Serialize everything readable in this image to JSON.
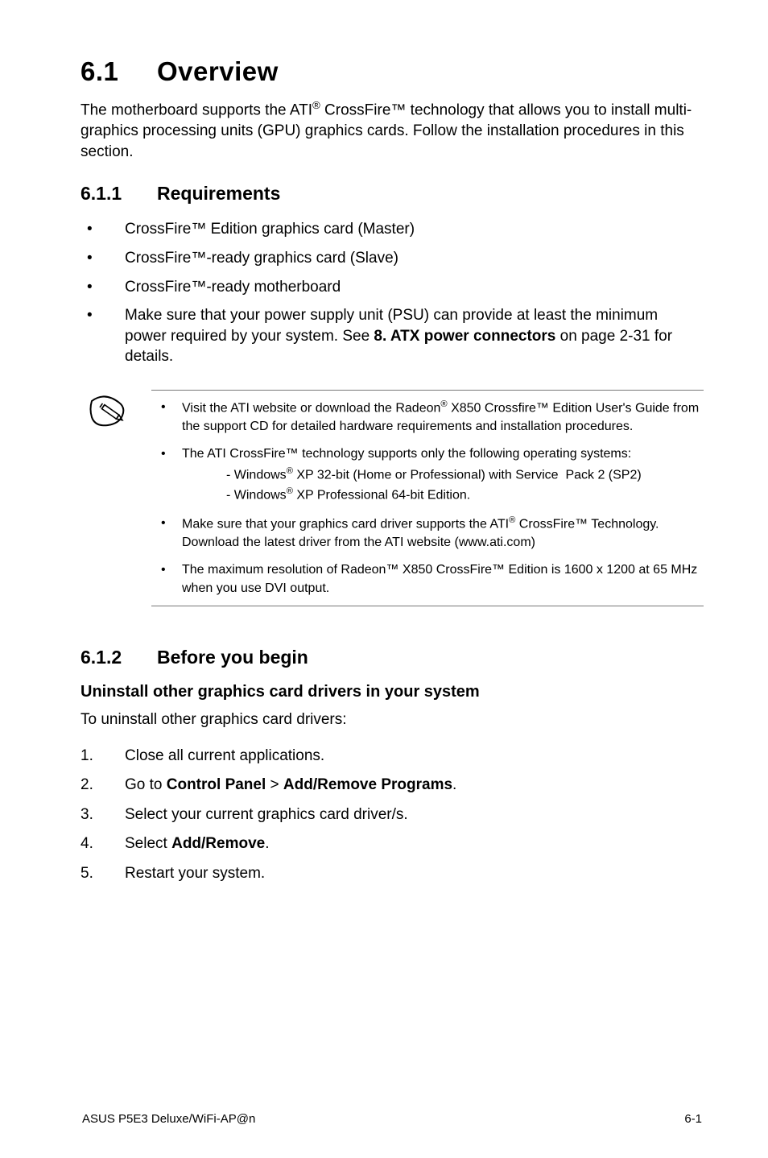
{
  "heading": {
    "num": "6.1",
    "title": "Overview"
  },
  "intro": "The motherboard supports the ATI® CrossFire™ technology that allows you to install multi-graphics processing units (GPU) graphics cards. Follow the installation procedures in this section.",
  "sec611": {
    "num": "6.1.1",
    "title": "Requirements",
    "items": [
      "CrossFire™ Edition graphics card (Master)",
      "CrossFire™-ready graphics card (Slave)",
      "CrossFire™-ready motherboard",
      "Make sure that your power supply unit (PSU) can provide at least the minimum power required by your system. See 8. ATX power connectors on page 2-31 for details."
    ]
  },
  "note": {
    "n1": "Visit the ATI website or download the Radeon® X850 Crossfire™ Edition User's Guide from the support CD for detailed hardware requirements and installation procedures.",
    "n2": "The ATI CrossFire™ technology supports only the following operating systems:",
    "n2_sub1": "- Windows® XP 32-bit  (Home or Professional) with Service Pack 2 (SP2)",
    "n2_sub2": "- Windows® XP Professional 64-bit Edition.",
    "n3": "Make sure that your graphics card driver supports the ATI® CrossFire™ Technology. Download the latest driver from the ATI website (www.ati.com)",
    "n4": "The maximum resolution of Radeon™ X850 CrossFire™ Edition is 1600 x 1200 at 65 MHz when you use DVI output."
  },
  "sec612": {
    "num": "6.1.2",
    "title": "Before you begin",
    "subheading": "Uninstall other graphics card drivers in your system",
    "lead": "To uninstall other graphics card drivers:",
    "steps": {
      "s1": "Close all current applications.",
      "s2_pre": "Go to ",
      "s2_b1": "Control Panel",
      "s2_mid": " > ",
      "s2_b2": "Add/Remove Programs",
      "s2_post": ".",
      "s3": "Select your current graphics card driver/s.",
      "s4_pre": "Select ",
      "s4_b": "Add/Remove",
      "s4_post": ".",
      "s5": "Restart your system."
    }
  },
  "footer": {
    "left": "ASUS P5E3 Deluxe/WiFi-AP@n",
    "right": "6-1"
  }
}
